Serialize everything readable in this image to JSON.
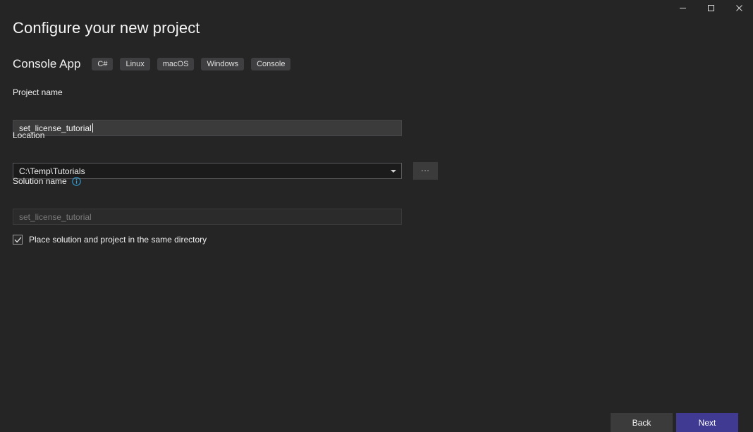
{
  "window": {
    "controls": [
      {
        "name": "minimize",
        "glyph": "minimize-icon"
      },
      {
        "name": "maximize",
        "glyph": "maximize-icon"
      },
      {
        "name": "close",
        "glyph": "close-icon"
      }
    ]
  },
  "page": {
    "title": "Configure your new project"
  },
  "template": {
    "name": "Console App",
    "tags": [
      "C#",
      "Linux",
      "macOS",
      "Windows",
      "Console"
    ]
  },
  "form": {
    "project_name": {
      "label": "Project name",
      "value": "set_license_tutorial",
      "placeholder": ""
    },
    "location": {
      "label": "Location",
      "value": "C:\\Temp\\Tutorials",
      "placeholder": "",
      "browse_label": "..."
    },
    "solution_name": {
      "label": "Solution name",
      "value": "",
      "placeholder": "set_license_tutorial",
      "info_tooltip": "Solution name"
    },
    "same_directory": {
      "label": "Place solution and project in the same directory",
      "checked": true,
      "check_glyph": "✓"
    }
  },
  "footer": {
    "back_label": "Back",
    "next_label": "Next"
  },
  "colors": {
    "background": "#252526",
    "accent": "#413a92",
    "tag_background": "#3f3f41",
    "input_background": "#3b3b3c",
    "combobox_background": "#1b1b1c",
    "info_icon": "#2f9fd8",
    "text": "#f0f0f0",
    "text_disabled": "#7a7a7a"
  }
}
